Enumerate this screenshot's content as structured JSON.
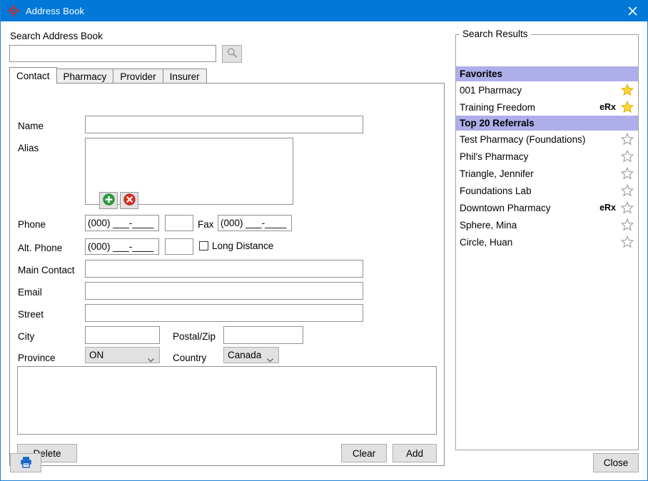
{
  "window": {
    "title": "Address Book",
    "icon": "target-crosshair-icon",
    "close_icon": "close-icon",
    "titlebar_color": "#0078d7"
  },
  "search": {
    "label": "Search Address Book",
    "value": "",
    "placeholder": "",
    "button_icon": "magnifier-icon"
  },
  "tabs": [
    {
      "label": "Contact",
      "active": true
    },
    {
      "label": "Pharmacy",
      "active": false
    },
    {
      "label": "Provider",
      "active": false
    },
    {
      "label": "Insurer",
      "active": false
    }
  ],
  "contact_form": {
    "name": {
      "label": "Name",
      "value": "",
      "placeholder": ""
    },
    "alias": {
      "label": "Alias",
      "value": ""
    },
    "alias_add_icon": "green-plus-icon",
    "alias_remove_icon": "red-x-icon",
    "phone": {
      "label": "Phone",
      "value": "",
      "placeholder": "(000) ___-____"
    },
    "phone_ext": {
      "value": "",
      "placeholder": ""
    },
    "fax": {
      "label": "Fax",
      "value": "",
      "placeholder": "(000) ___-____"
    },
    "alt_phone": {
      "label": "Alt. Phone",
      "value": "",
      "placeholder": "(000) ___-____"
    },
    "alt_ext": {
      "value": "",
      "placeholder": ""
    },
    "long_distance": {
      "label": "Long Distance",
      "checked": false
    },
    "main_contact": {
      "label": "Main Contact",
      "value": "",
      "placeholder": ""
    },
    "email": {
      "label": "Email",
      "value": "",
      "placeholder": ""
    },
    "street": {
      "label": "Street",
      "value": "",
      "placeholder": ""
    },
    "city": {
      "label": "City",
      "value": "",
      "placeholder": ""
    },
    "postal": {
      "label": "Postal/Zip",
      "value": "",
      "placeholder": ""
    },
    "province": {
      "label": "Province",
      "value": "ON"
    },
    "country": {
      "label": "Country",
      "value": "Canada"
    },
    "notes": {
      "value": ""
    },
    "delete_label": "Delete",
    "clear_label": "Clear",
    "add_label": "Add"
  },
  "results": {
    "legend": "Search Results",
    "header_bg": "#aeaeea",
    "star_filled_color": "#ffd732",
    "rows": [
      {
        "type": "header",
        "label": "Favorites"
      },
      {
        "type": "item",
        "label": "001 Pharmacy",
        "erx": "",
        "starred": true
      },
      {
        "type": "item",
        "label": "Training Freedom",
        "erx": "eRx",
        "starred": true
      },
      {
        "type": "header",
        "label": "Top 20 Referrals"
      },
      {
        "type": "item",
        "label": "Test Pharmacy (Foundations)",
        "erx": "",
        "starred": false
      },
      {
        "type": "item",
        "label": "Phil's Pharmacy",
        "erx": "",
        "starred": false
      },
      {
        "type": "item",
        "label": "Triangle, Jennifer",
        "erx": "",
        "starred": false
      },
      {
        "type": "item",
        "label": "Foundations Lab",
        "erx": "",
        "starred": false
      },
      {
        "type": "item",
        "label": "Downtown Pharmacy",
        "erx": "eRx",
        "starred": false
      },
      {
        "type": "item",
        "label": "Sphere, Mina",
        "erx": "",
        "starred": false
      },
      {
        "type": "item",
        "label": "Circle, Huan",
        "erx": "",
        "starred": false
      }
    ]
  },
  "footer": {
    "print_icon": "printer-icon",
    "close_label": "Close"
  }
}
